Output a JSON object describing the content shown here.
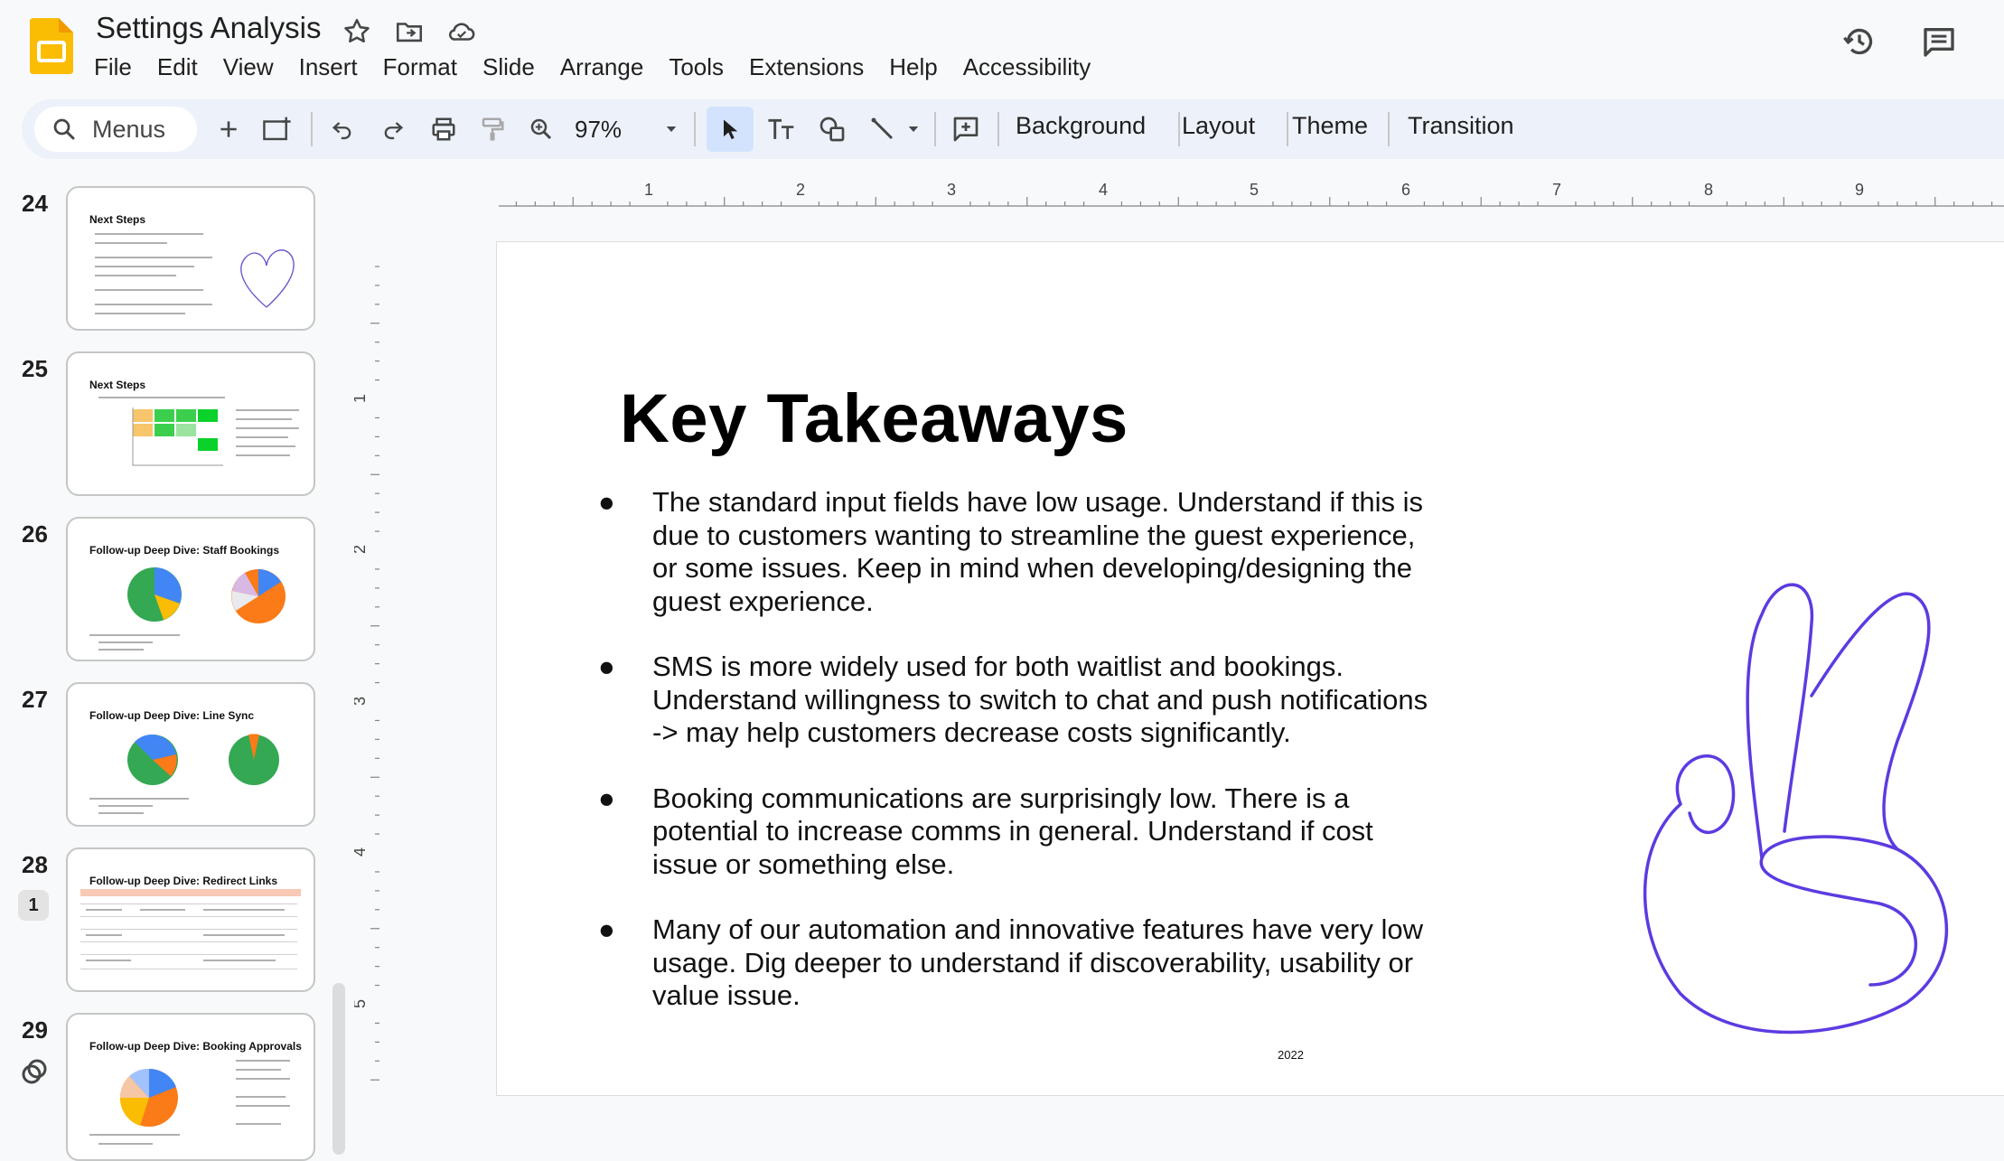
{
  "app": {
    "title": "Settings Analysis",
    "menu": [
      "File",
      "Edit",
      "View",
      "Insert",
      "Format",
      "Slide",
      "Arrange",
      "Tools",
      "Extensions",
      "Help",
      "Accessibility"
    ],
    "accent_color": "#fbbc04"
  },
  "toolbar": {
    "menus_placeholder": "Menus",
    "zoom": "97%",
    "background_label": "Background",
    "layout_label": "Layout",
    "theme_label": "Theme",
    "transition_label": "Transition",
    "icons": [
      "add-icon",
      "new-slide-icon",
      "undo-icon",
      "redo-icon",
      "print-icon",
      "paint-format-icon",
      "zoom-icon",
      "select-icon",
      "text-box-icon",
      "shapes-icon",
      "line-icon",
      "add-comment-icon"
    ]
  },
  "filmstrip": {
    "slides": [
      {
        "number": "24",
        "title": "Next Steps"
      },
      {
        "number": "25",
        "title": "Next Steps"
      },
      {
        "number": "26",
        "title": "Follow-up Deep Dive: Staff Bookings"
      },
      {
        "number": "27",
        "title": "Follow-up Deep Dive: Line Sync"
      },
      {
        "number": "28",
        "title": "Follow-up Deep Dive: Redirect Links"
      },
      {
        "number": "29",
        "title": "Follow-up Deep Dive: Booking Approvals"
      }
    ],
    "comment_count": "1"
  },
  "ruler": {
    "horizontal": [
      "1",
      "2",
      "3",
      "4",
      "5",
      "6",
      "7",
      "8",
      "9"
    ],
    "vertical": [
      "1",
      "2",
      "3",
      "4",
      "5"
    ]
  },
  "slide": {
    "title": "Key Takeaways",
    "bullets": [
      "The standard input fields have low usage. Understand if this is due to customers wanting to streamline the guest experience, or some issues. Keep in mind when developing/designing the guest experience.",
      "SMS is more widely used for both waitlist and bookings. Understand willingness to switch to chat and push notifications -> may help customers decrease costs significantly.",
      "Booking communications are surprisingly low. There is a potential to increase comms in general. Understand if cost issue or something else.",
      "Many of our automation and innovative features have very low usage. Dig deeper to understand if discoverability, usability or value issue."
    ],
    "year": "2022",
    "drawing_color": "#5c3be0"
  }
}
